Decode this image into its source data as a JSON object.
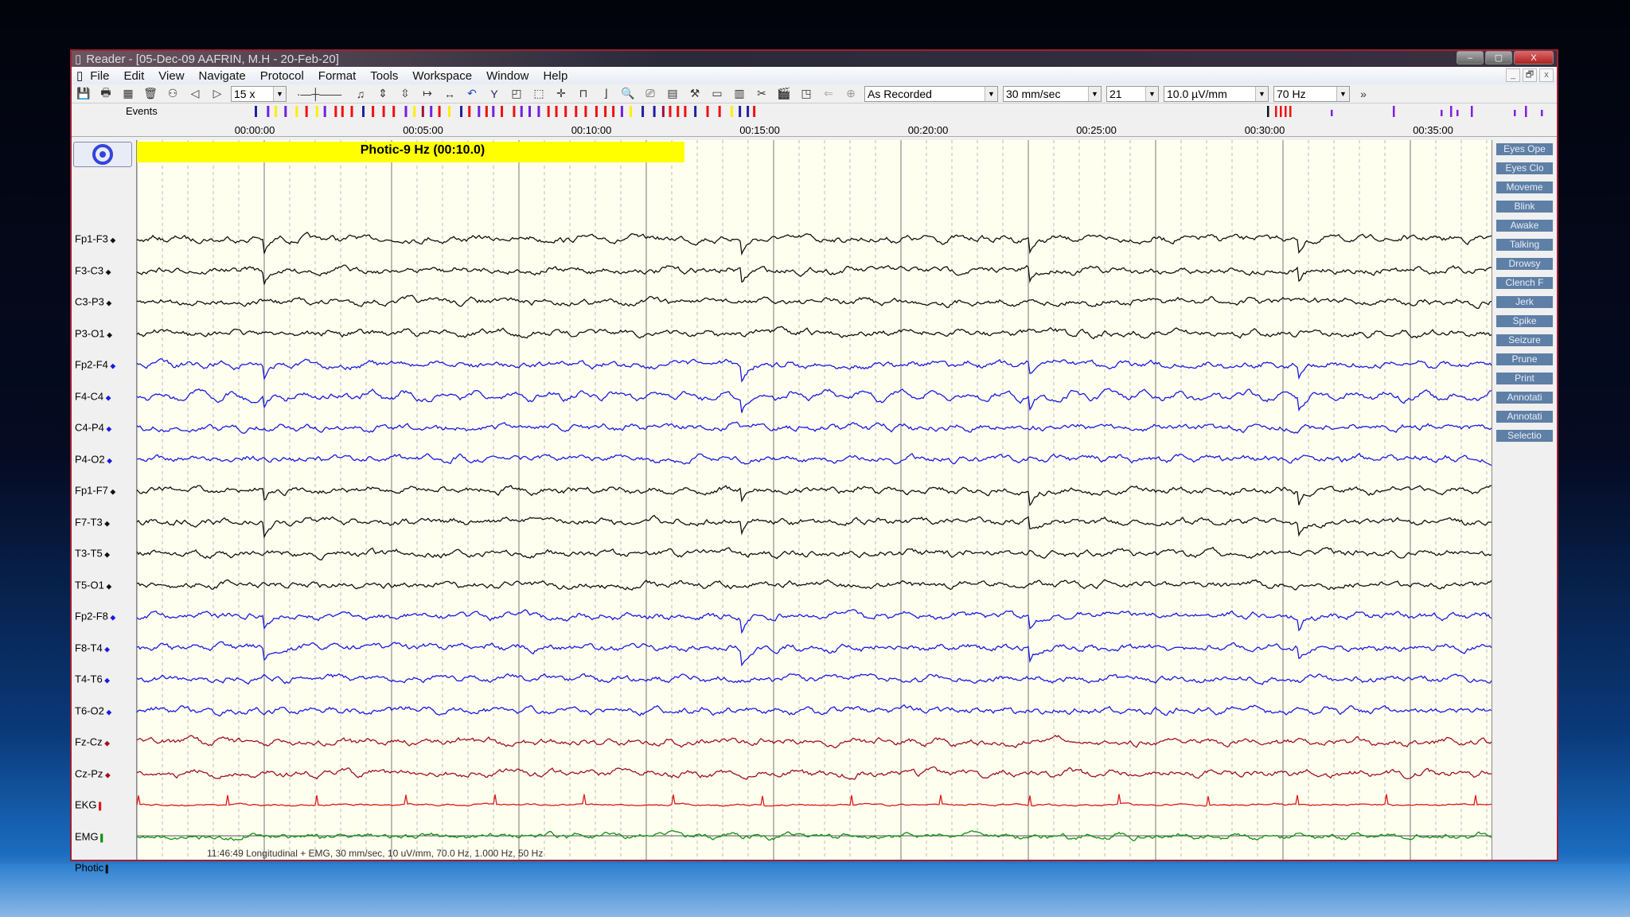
{
  "window": {
    "title": "Reader - [05-Dec-09 AAFRIN, M.H - 20-Feb-20]",
    "minimize": "–",
    "maximize": "▢",
    "close": "X"
  },
  "menu": [
    "File",
    "Edit",
    "View",
    "Navigate",
    "Protocol",
    "Format",
    "Tools",
    "Workspace",
    "Window",
    "Help"
  ],
  "mdi": {
    "minimize": "_",
    "restore": "🗗",
    "close": "x"
  },
  "toolbar": {
    "zoom": "15 x",
    "montage": "As Recorded",
    "speed": "30 mm/sec",
    "channels": "21",
    "sensitivity": "10.0 µV/mm",
    "filter": "70 Hz",
    "more": "»"
  },
  "events": {
    "label": "Events"
  },
  "ruler": [
    "00:00:00",
    "00:05:00",
    "00:10:00",
    "00:15:00",
    "00:20:00",
    "00:25:00",
    "00:30:00",
    "00:35:00"
  ],
  "photic_banner": "Photic-9 Hz (00:10.0)",
  "channels": [
    {
      "name": "Fp1-F3",
      "color": "#111111"
    },
    {
      "name": "F3-C3",
      "color": "#111111"
    },
    {
      "name": "C3-P3",
      "color": "#111111"
    },
    {
      "name": "P3-O1",
      "color": "#111111"
    },
    {
      "name": "Fp2-F4",
      "color": "#1a1ae0"
    },
    {
      "name": "F4-C4",
      "color": "#1a1ae0"
    },
    {
      "name": "C4-P4",
      "color": "#1a1ae0"
    },
    {
      "name": "P4-O2",
      "color": "#1a1ae0"
    },
    {
      "name": "Fp1-F7",
      "color": "#111111"
    },
    {
      "name": "F7-T3",
      "color": "#111111"
    },
    {
      "name": "T3-T5",
      "color": "#111111"
    },
    {
      "name": "T5-O1",
      "color": "#111111"
    },
    {
      "name": "Fp2-F8",
      "color": "#1a1ae0"
    },
    {
      "name": "F8-T4",
      "color": "#1a1ae0"
    },
    {
      "name": "T4-T6",
      "color": "#1a1ae0"
    },
    {
      "name": "T6-O2",
      "color": "#1a1ae0"
    },
    {
      "name": "Fz-Cz",
      "color": "#a01020"
    },
    {
      "name": "Cz-Pz",
      "color": "#a01020"
    },
    {
      "name": "EKG",
      "color": "#e01818"
    },
    {
      "name": "EMG",
      "color": "#129012"
    },
    {
      "name": "Photic",
      "color": "#111111"
    }
  ],
  "markers": [
    "Eyes Ope",
    "Eyes Clo",
    "Moveme",
    "Blink",
    "Awake",
    "Talking",
    "Drowsy",
    "Clench F",
    "Jerk",
    "Spike",
    "Seizure",
    "Prune",
    "Print",
    "Annotati",
    "Annotati",
    "Selectio"
  ],
  "status": "11:46:49 Longitudinal + EMG, 30 mm/sec, 10 uV/mm, 70.0 Hz, 1.000 Hz, 50 Hz"
}
